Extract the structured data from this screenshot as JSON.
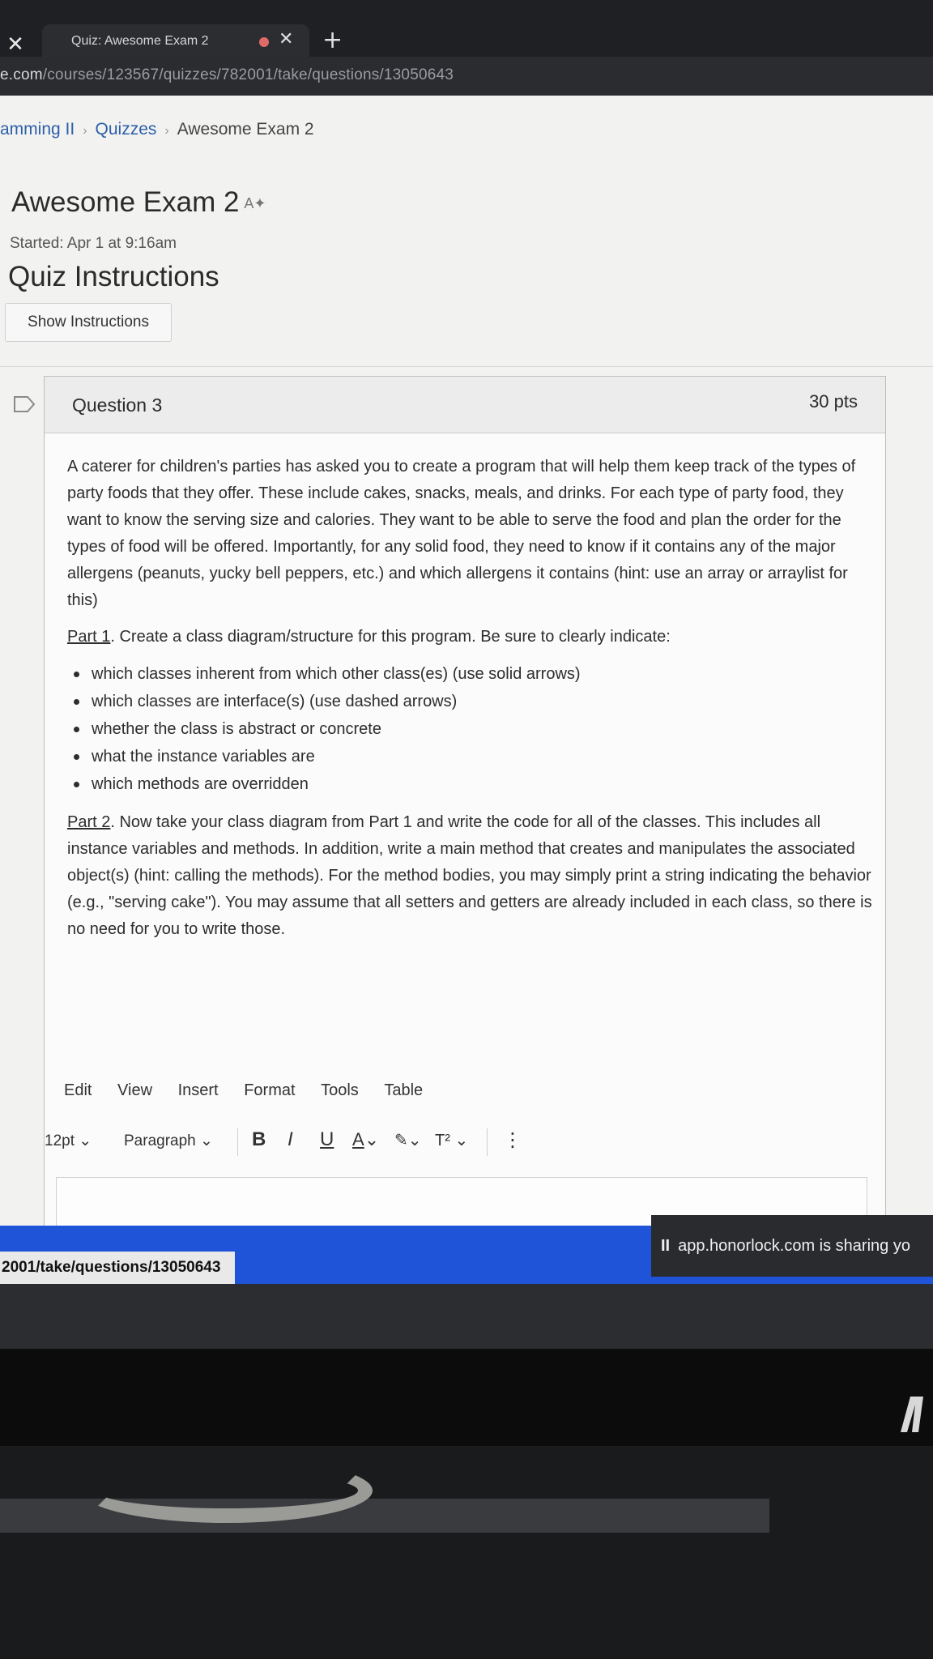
{
  "browser": {
    "tab_close_glyph": "✕",
    "tab_title": "Quiz: Awesome Exam 2",
    "tab_close": "✕",
    "new_tab": "+",
    "url_host": "e.com",
    "url_path": "/courses/123567/quizzes/782001/take/questions/13050643"
  },
  "breadcrumb": {
    "course": "amming II",
    "quizzes": "Quizzes",
    "exam": "Awesome Exam 2"
  },
  "quiz": {
    "title": "Awesome Exam 2",
    "title_icon": "A✦",
    "started": "Started: Apr 1 at 9:16am",
    "instructions_heading": "Quiz Instructions",
    "show_instructions_label": "Show Instructions"
  },
  "question": {
    "title": "Question 3",
    "points": "30 pts",
    "intro_parts": [
      "A caterer for children's parties has asked you to create a program that will help them keep track of the types of party foods that they offer. These include cakes, snacks, meals, and drinks. For each type of party food, they want to know the serving size and calories. They want to be able to serve the food and plan the order for the types of food will be offered. Importantly, for any solid food, they need to know if it contains any of the major allergens (peanuts, yucky bell peppers, etc.) and which allergens it contains (hint: use an array or arraylist for this)"
    ],
    "part1_label": "Part 1",
    "part1_text": ". Create a class diagram/structure for this program. Be sure to clearly indicate:",
    "bullets": [
      "which classes inherent from which other class(es) (use solid arrows)",
      "which classes are interface(s) (use dashed arrows)",
      "whether the class is abstract or concrete",
      "what the instance variables are",
      "which methods are overridden"
    ],
    "part2_label": "Part 2",
    "part2_text": ". Now take your class diagram from Part 1 and write the code for all of the classes. This includes all instance variables and methods. In addition, write a main method that creates and manipulates the associated object(s) (hint: calling the methods). For the method bodies, you may simply print a string indicating the behavior (e.g., \"serving cake\"). You may assume that all setters and getters are already included in each class, so there is no need for you to write those."
  },
  "editor": {
    "menu": [
      "Edit",
      "View",
      "Insert",
      "Format",
      "Tools",
      "Table"
    ],
    "font_size": "12pt",
    "block_format": "Paragraph",
    "bold": "B",
    "italic": "I",
    "underline": "U",
    "text_color": "A",
    "highlight": "✎",
    "superscript": "T²",
    "more": "⋮",
    "chevron": "⌄"
  },
  "statusbar": {
    "link_preview": "2001/take/questions/13050643"
  },
  "share_notice": {
    "pause_glyph": "II",
    "text": "app.honorlock.com is sharing yo"
  },
  "colors": {
    "link": "#2d5fa8",
    "statusbar": "#1f53d8",
    "page_bg": "#f2f2f1"
  }
}
